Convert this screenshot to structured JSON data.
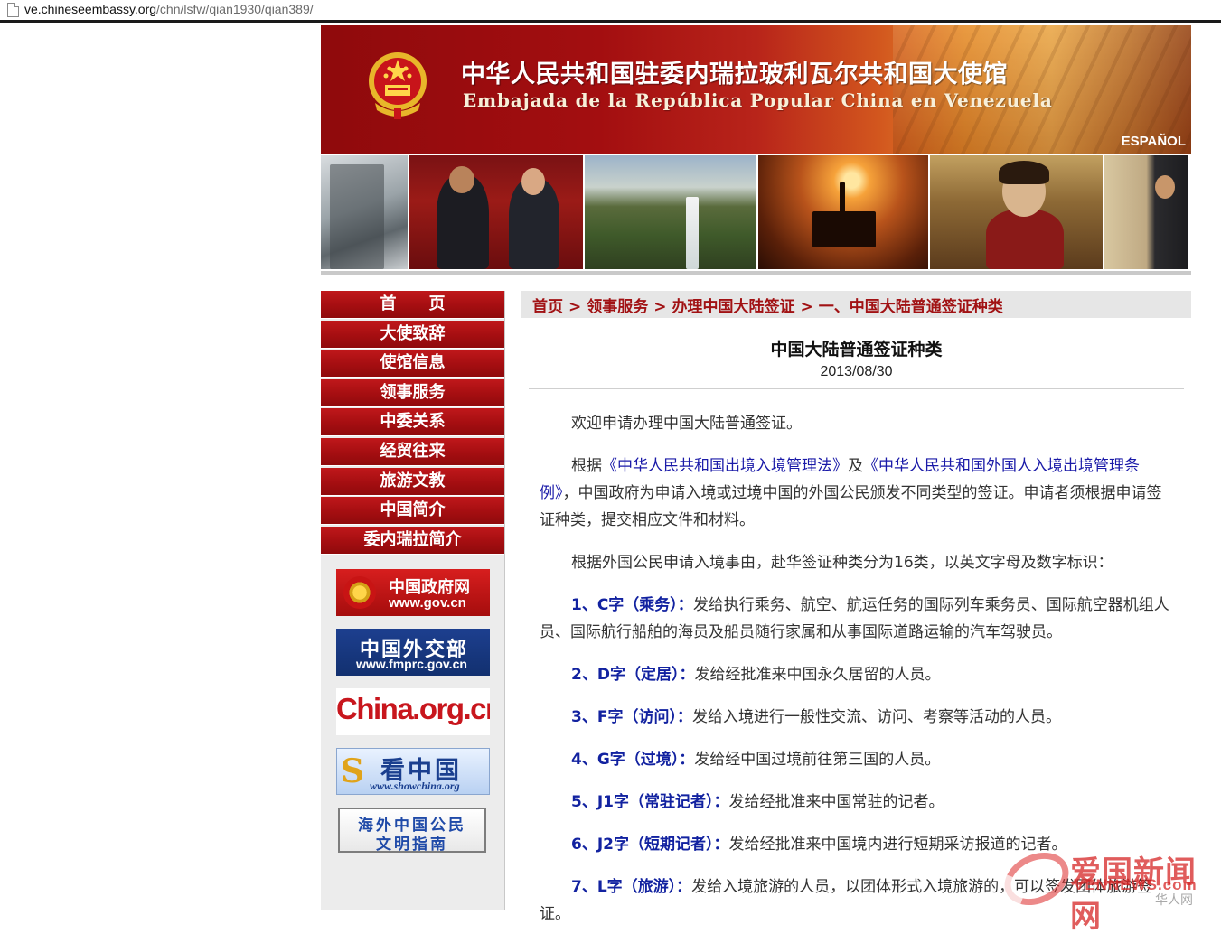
{
  "browser": {
    "url_host": "ve.chineseembassy.org",
    "url_path": "/chn/lsfw/qian1930/qian389/"
  },
  "banner": {
    "title_cn": "中华人民共和国驻委内瑞拉玻利瓦尔共和国大使馆",
    "title_es": "Embajada de la República Popular China en Venezuela",
    "lang_link": "ESPAÑOL"
  },
  "nav": {
    "items": [
      {
        "label": "首　　页"
      },
      {
        "label": "大使致辞"
      },
      {
        "label": "使馆信息"
      },
      {
        "label": "领事服务"
      },
      {
        "label": "中委关系"
      },
      {
        "label": "经贸往来"
      },
      {
        "label": "旅游文教"
      },
      {
        "label": "中国简介"
      },
      {
        "label": "委内瑞拉简介"
      }
    ]
  },
  "links": {
    "gov": {
      "cn": "中国政府网",
      "url": "www.gov.cn"
    },
    "mfa": {
      "cn": "中国外交部",
      "url": "www.fmprc.gov.cn"
    },
    "china_org": {
      "text": "China.org.cn"
    },
    "showchina": {
      "cn": "看中国",
      "url": "www.showchina.org"
    },
    "guide": {
      "line1": "海外中国公民",
      "line2": "文明指南"
    }
  },
  "breadcrumb": {
    "items": [
      "首页",
      "领事服务",
      "办理中国大陆签证",
      "一、中国大陆普通签证种类"
    ],
    "separator": ">"
  },
  "article": {
    "title": "中国大陆普通签证种类",
    "date": "2013/08/30",
    "intro": "欢迎申请办理中国大陆普通签证。",
    "p2_prefix": "根据",
    "law1": "《中华人民共和国出境入境管理法》",
    "p2_and": "及",
    "law2": "《中华人民共和国外国人入境出境管理条例》",
    "p2_rest": "，中国政府为申请入境或过境中国的外国公民颁发不同类型的签证。申请者须根据申请签证种类，提交相应文件和材料。",
    "p3": "根据外国公民申请入境事由，赴华签证种类分为16类，以英文字母及数字标识：",
    "visa_types": [
      {
        "label": "1、C字（乘务）：",
        "desc": "发给执行乘务、航空、航运任务的国际列车乘务员、国际航空器机组人员、国际航行船舶的海员及船员随行家属和从事国际道路运输的汽车驾驶员。"
      },
      {
        "label": "2、D字（定居）：",
        "desc": "发给经批准来中国永久居留的人员。"
      },
      {
        "label": "3、F字（访问）：",
        "desc": "发给入境进行一般性交流、访问、考察等活动的人员。"
      },
      {
        "label": "4、G字（过境）：",
        "desc": "发给经中国过境前往第三国的人员。"
      },
      {
        "label": "5、J1字（常驻记者）：",
        "desc": "发给经批准来中国常驻的记者。"
      },
      {
        "label": "6、J2字（短期记者）：",
        "desc": "发给经批准来中国境内进行短期采访报道的记者。"
      },
      {
        "label": "7、L字（旅游）：",
        "desc": "发给入境旅游的人员，以团体形式入境旅游的，可以签发团体旅游签证。"
      }
    ]
  },
  "watermark": {
    "cn": "爱国新闻网",
    "en": "VENNEWS.com",
    "sub": "华人网"
  },
  "colors": {
    "nav_red": "#a50e11",
    "breadcrumb_red": "#a11214",
    "link_blue": "#1a1aa8",
    "visa_label_blue": "#1222a0"
  }
}
